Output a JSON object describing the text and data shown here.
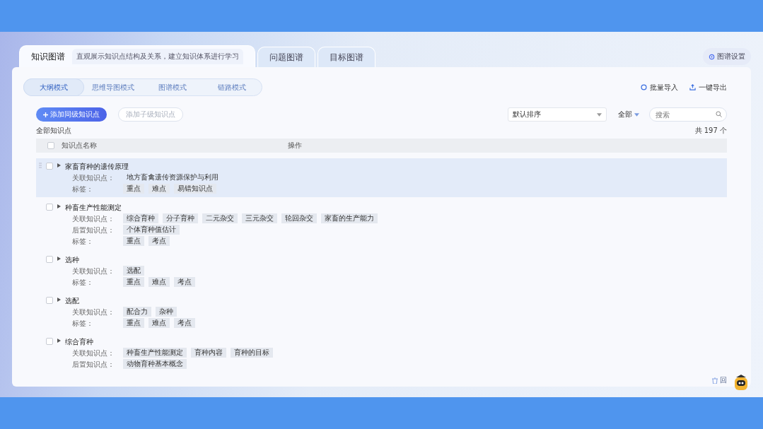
{
  "tabs": [
    {
      "label": "知识图谱",
      "subtitle": "直观展示知识点结构及关系，建立知识体系进行学习",
      "selected": true
    },
    {
      "label": "问题图谱",
      "selected": false
    },
    {
      "label": "目标图谱",
      "selected": false
    }
  ],
  "settings_button": "图谱设置",
  "modes": [
    {
      "label": "大纲模式",
      "selected": true
    },
    {
      "label": "思维导图模式",
      "selected": false
    },
    {
      "label": "图谱模式",
      "selected": false
    },
    {
      "label": "链路模式",
      "selected": false
    }
  ],
  "actions": [
    "批量导入",
    "一键导出"
  ],
  "toolbar": {
    "add_sibling": "添加同级知识点",
    "add_child": {
      "label": "添加子级知识点",
      "disabled": true
    },
    "sort": "默认排序",
    "filter": "全部",
    "search": {
      "placeholder": "搜索"
    }
  },
  "section_label": "全部知识点",
  "total": "共 197 个",
  "table": {
    "all_checked": false,
    "columns": [
      "知识点名称",
      "操作"
    ],
    "rows": [
      {
        "title": "家畜育种的遗传原理",
        "selected": true,
        "checked": false,
        "fields": [
          {
            "label": "关联知识点：",
            "values": [
              "地方畜禽遗传资源保护与利用"
            ],
            "kind": "plain"
          },
          {
            "label": "标签：",
            "values": [
              "重点",
              "难点",
              "易错知识点"
            ],
            "kind": "tags"
          }
        ]
      },
      {
        "title": "种畜生产性能测定",
        "selected": false,
        "checked": false,
        "fields": [
          {
            "label": "关联知识点：",
            "values": [
              "综合育种",
              "分子育种",
              "二元杂交",
              "三元杂交",
              "轮回杂交",
              "家畜的生产能力"
            ],
            "kind": "tags"
          },
          {
            "label": "后置知识点：",
            "values": [
              "个体育种值估计"
            ],
            "kind": "tags"
          },
          {
            "label": "标签：",
            "values": [
              "重点",
              "考点"
            ],
            "kind": "tags"
          }
        ]
      },
      {
        "title": "选种",
        "selected": false,
        "checked": false,
        "fields": [
          {
            "label": "关联知识点：",
            "values": [
              "选配"
            ],
            "kind": "tags"
          },
          {
            "label": "标签：",
            "values": [
              "重点",
              "难点",
              "考点"
            ],
            "kind": "tags"
          }
        ]
      },
      {
        "title": "选配",
        "selected": false,
        "checked": false,
        "fields": [
          {
            "label": "关联知识点：",
            "values": [
              "配合力",
              "杂种"
            ],
            "kind": "tags"
          },
          {
            "label": "标签：",
            "values": [
              "重点",
              "难点",
              "考点"
            ],
            "kind": "tags"
          }
        ]
      },
      {
        "title": "综合育种",
        "selected": false,
        "checked": false,
        "fields": [
          {
            "label": "关联知识点：",
            "values": [
              "种畜生产性能测定",
              "育种内容",
              "育种的目标"
            ],
            "kind": "tags"
          },
          {
            "label": "后置知识点：",
            "values": [
              "动物育种基本概念"
            ],
            "kind": "tags"
          }
        ]
      }
    ]
  },
  "recycle": "回"
}
